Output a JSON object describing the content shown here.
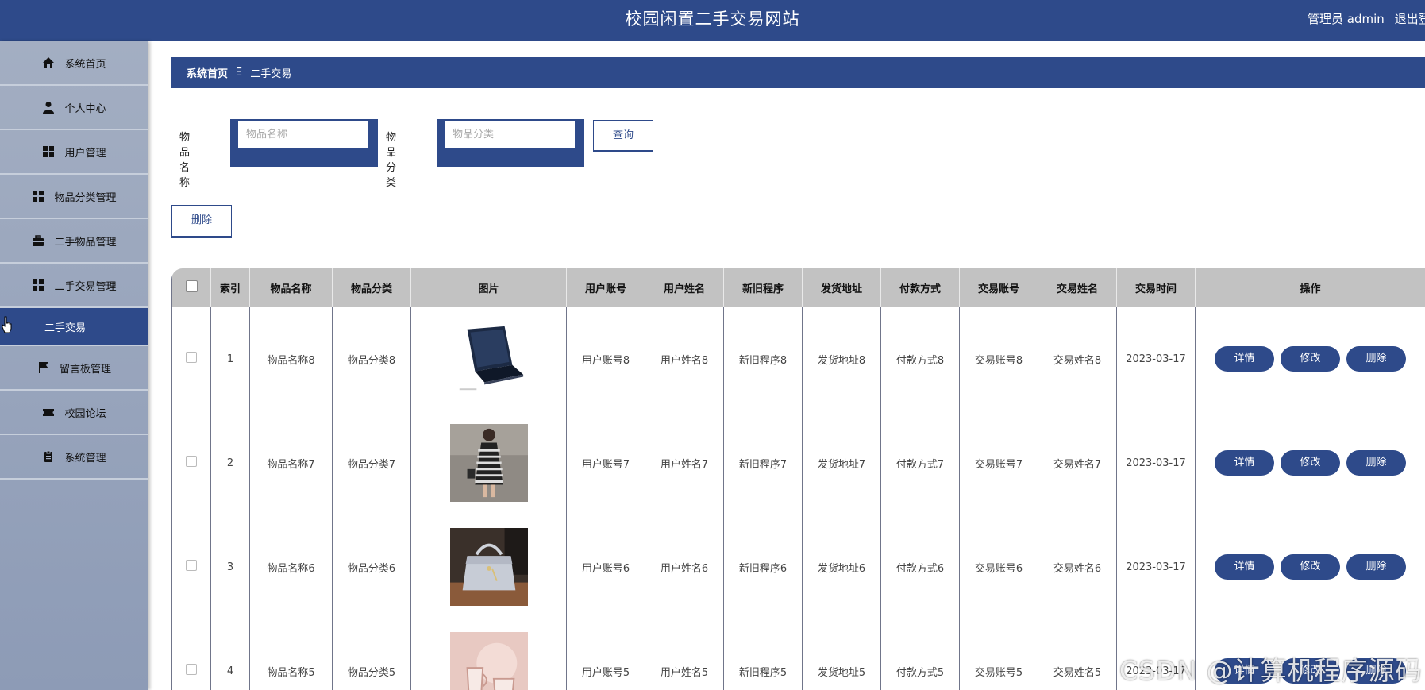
{
  "header": {
    "title": "校园闲置二手交易网站",
    "user": "管理员 admin",
    "logout": "退出登录"
  },
  "sidebar": {
    "items": [
      {
        "label": "系统首页",
        "icon": "home-icon"
      },
      {
        "label": "个人中心",
        "icon": "person-icon"
      },
      {
        "label": "用户管理",
        "icon": "grid-icon"
      },
      {
        "label": "物品分类管理",
        "icon": "grid-icon"
      },
      {
        "label": "二手物品管理",
        "icon": "briefcase-icon"
      },
      {
        "label": "二手交易管理",
        "icon": "grid-icon"
      },
      {
        "label": "二手交易",
        "icon": "",
        "sub": true
      },
      {
        "label": "留言板管理",
        "icon": "flag-icon"
      },
      {
        "label": "校园论坛",
        "icon": "ticket-icon"
      },
      {
        "label": "系统管理",
        "icon": "clipboard-icon"
      }
    ]
  },
  "breadcrumb": {
    "home": "系统首页",
    "sep": "Ξ",
    "current": "二手交易"
  },
  "search": {
    "name_label": "物品名称",
    "name_placeholder": "物品名称",
    "category_label": "物品分类",
    "category_placeholder": "物品分类",
    "query_button": "查询"
  },
  "toolbar": {
    "delete_button": "删除"
  },
  "table": {
    "headers": [
      "",
      "索引",
      "物品名称",
      "物品分类",
      "图片",
      "用户账号",
      "用户姓名",
      "新旧程序",
      "发货地址",
      "付款方式",
      "交易账号",
      "交易姓名",
      "交易时间",
      "操作"
    ],
    "rows": [
      {
        "index": "1",
        "name": "物品名称8",
        "category": "物品分类8",
        "image": "laptop",
        "account": "用户账号8",
        "username": "用户姓名8",
        "condition": "新旧程序8",
        "address": "发货地址8",
        "payment": "付款方式8",
        "trade_account": "交易账号8",
        "trade_name": "交易姓名8",
        "time": "2023-03-17"
      },
      {
        "index": "2",
        "name": "物品名称7",
        "category": "物品分类7",
        "image": "dress",
        "account": "用户账号7",
        "username": "用户姓名7",
        "condition": "新旧程序7",
        "address": "发货地址7",
        "payment": "付款方式7",
        "trade_account": "交易账号7",
        "trade_name": "交易姓名7",
        "time": "2023-03-17"
      },
      {
        "index": "3",
        "name": "物品名称6",
        "category": "物品分类6",
        "image": "handbag",
        "account": "用户账号6",
        "username": "用户姓名6",
        "condition": "新旧程序6",
        "address": "发货地址6",
        "payment": "付款方式6",
        "trade_account": "交易账号6",
        "trade_name": "交易姓名6",
        "time": "2023-03-17"
      },
      {
        "index": "4",
        "name": "物品名称5",
        "category": "物品分类5",
        "image": "cups",
        "account": "用户账号5",
        "username": "用户姓名5",
        "condition": "新旧程序5",
        "address": "发货地址5",
        "payment": "付款方式5",
        "trade_account": "交易账号5",
        "trade_name": "交易姓名5",
        "time": "2023-03-17"
      }
    ],
    "actions": {
      "detail": "详情",
      "edit": "修改",
      "delete": "删除"
    }
  },
  "watermark": "CSDN @计算机程序源码",
  "colors": {
    "primary": "#2e4a8a",
    "header_bg": "#c2c2c2",
    "sidebar_bg": "#a3aec2"
  }
}
